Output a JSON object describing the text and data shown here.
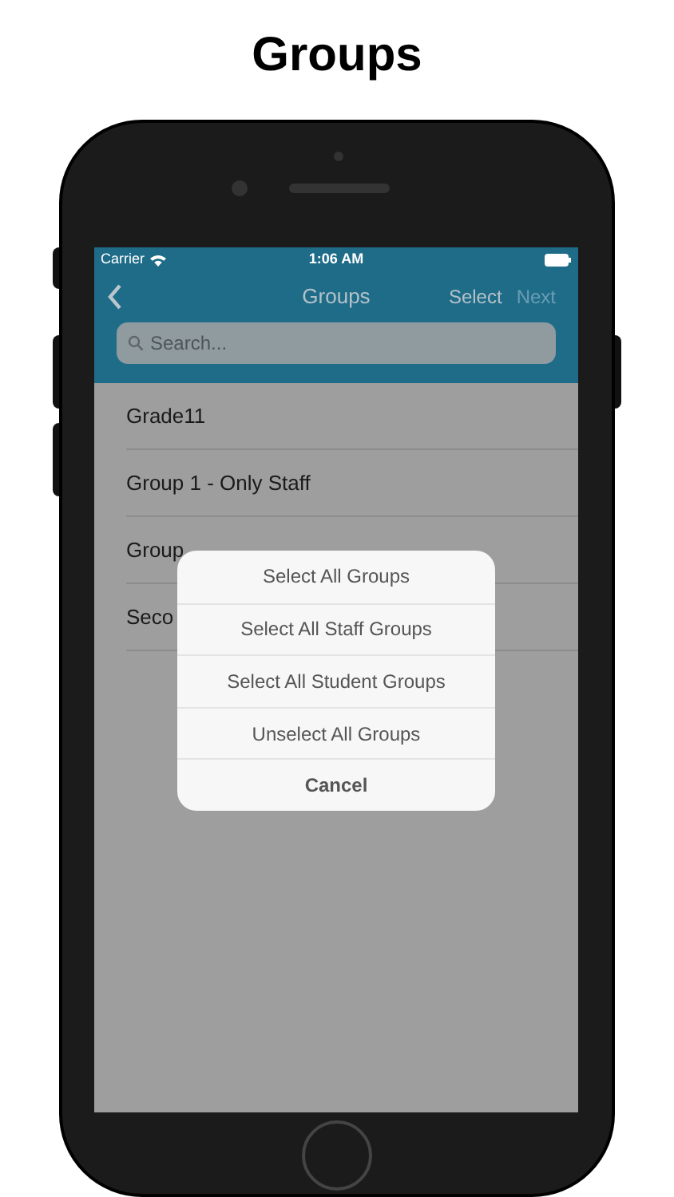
{
  "headline": "Groups",
  "status_bar": {
    "carrier": "Carrier",
    "time": "1:06 AM"
  },
  "nav": {
    "title": "Groups",
    "actions": [
      {
        "label": "Select",
        "disabled": false
      },
      {
        "label": "Next",
        "disabled": true
      }
    ]
  },
  "search": {
    "placeholder": "Search..."
  },
  "groups": [
    "Grade11",
    "Group 1 - Only Staff",
    "Group",
    "Seco"
  ],
  "action_sheet": {
    "items": [
      {
        "label": "Select All Groups",
        "kind": "action"
      },
      {
        "label": "Select All Staff Groups",
        "kind": "action"
      },
      {
        "label": "Select All Student Groups",
        "kind": "action"
      },
      {
        "label": "Unselect All Groups",
        "kind": "action"
      },
      {
        "label": "Cancel",
        "kind": "cancel"
      }
    ]
  }
}
